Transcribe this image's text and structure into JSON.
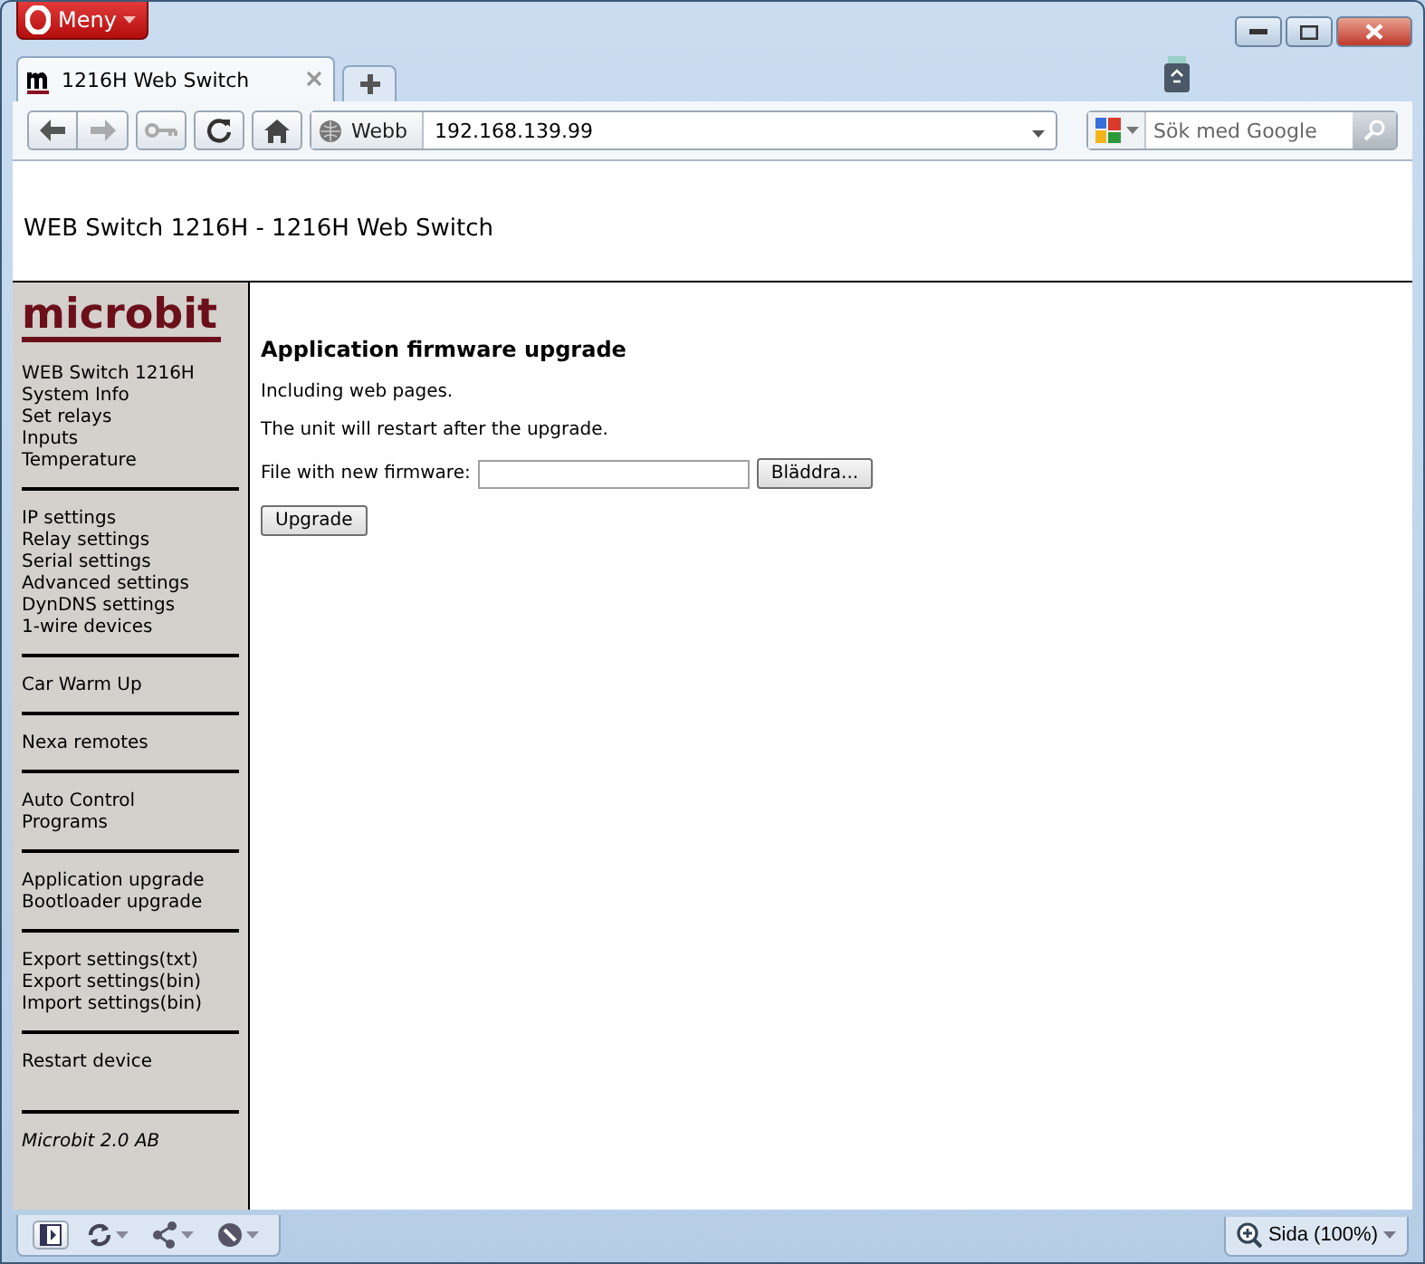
{
  "browser": {
    "menu_label": "Meny",
    "tabs": [
      {
        "label": "1216H Web Switch",
        "selected": true
      }
    ],
    "address_prefix": "Webb",
    "address": "192.168.139.99",
    "search_placeholder": "Sök med Google",
    "zoom_label": "Sida (100%)"
  },
  "page": {
    "header_title": "WEB Switch 1216H - 1216H Web Switch",
    "logo": "microbit",
    "sidebar_groups": [
      [
        "WEB Switch 1216H",
        "System Info",
        "Set relays",
        "Inputs",
        "Temperature"
      ],
      [
        "IP settings",
        "Relay settings",
        "Serial settings",
        "Advanced settings",
        "DynDNS settings",
        "1-wire devices"
      ],
      [
        "Car Warm Up"
      ],
      [
        "Nexa remotes"
      ],
      [
        "Auto Control",
        "Programs"
      ],
      [
        "Application upgrade",
        "Bootloader upgrade"
      ],
      [
        "Export settings(txt)",
        "Export settings(bin)",
        "Import settings(bin)"
      ],
      [
        "Restart device"
      ]
    ],
    "footer": "Microbit 2.0 AB",
    "heading": "Application firmware upgrade",
    "paragraphs": [
      "Including web pages.",
      "The unit will restart after the upgrade."
    ],
    "file_label": "File with new firmware:",
    "browse_button": "Bläddra...",
    "submit_button": "Upgrade"
  }
}
